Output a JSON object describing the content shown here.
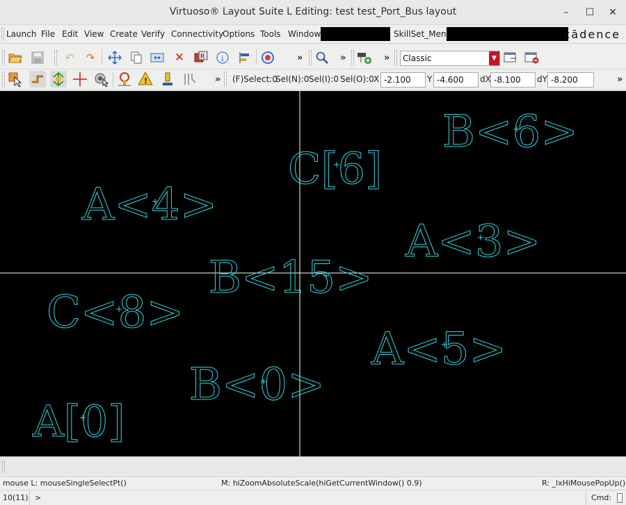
{
  "window": {
    "title": "Virtuoso® Layout Suite L Editing: test test_Port_Bus layout",
    "controls": {
      "minimize": "–",
      "maximize": "☐",
      "close": "✕"
    }
  },
  "menubar": {
    "items": [
      "Launch",
      "File",
      "Edit",
      "View",
      "Create",
      "Verify",
      "Connectivity",
      "Options",
      "Tools",
      "Window"
    ],
    "skillset": "SkillSet_Menu",
    "brand": "cādence"
  },
  "toolbar1": {
    "overflow": "»",
    "workspace": "Classic"
  },
  "toolbar2": {
    "overflow": "»",
    "selection": {
      "f_select": "(F)Select:0",
      "sel_n": "Sel(N):0",
      "sel_i": "Sel(I):0",
      "sel_o": "Sel(O):0"
    },
    "coords": {
      "x_label": "X",
      "x": "-2.100",
      "y_label": "Y",
      "y": "-4.600",
      "dx_label": "dX",
      "dx": "-8.100",
      "dy_label": "dY",
      "dy": "-8.200"
    }
  },
  "canvas": {
    "labels": [
      {
        "text": "B<6>"
      },
      {
        "text": "C[6]"
      },
      {
        "text": "A<4>"
      },
      {
        "text": "A<3>"
      },
      {
        "text": "B<15>"
      },
      {
        "text": "C<8>"
      },
      {
        "text": "A<5>"
      },
      {
        "text": "B<0>"
      },
      {
        "text": "A[0]"
      }
    ],
    "label_color": "#38d8e0",
    "crosshair_color": "#ffffff"
  },
  "status": {
    "mouse_l": "mouse L: mouseSingleSelectPt()",
    "mouse_m": "M: hiZoomAbsoluteScale(hiGetCurrentWindow() 0.9)",
    "mouse_r": "R: _lxHiMousePopUp()",
    "counter": "10(11)",
    "prompt": ">",
    "cmd_label": "Cmd:"
  }
}
